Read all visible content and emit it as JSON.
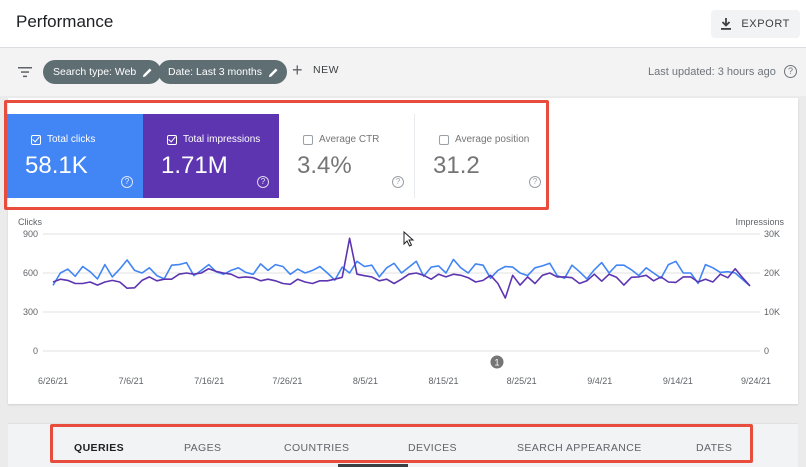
{
  "header": {
    "title": "Performance",
    "export_label": "EXPORT"
  },
  "filters": {
    "chips": [
      {
        "label": "Search type: Web"
      },
      {
        "label": "Date: Last 3 months"
      }
    ],
    "new_label": "NEW",
    "last_updated": "Last updated: 3 hours ago"
  },
  "metrics": [
    {
      "label": "Total clicks",
      "value": "58.1K",
      "checked": true,
      "color": "#4285f4"
    },
    {
      "label": "Total impressions",
      "value": "1.71M",
      "checked": true,
      "color": "#5e35b1"
    },
    {
      "label": "Average CTR",
      "value": "3.4%",
      "checked": false
    },
    {
      "label": "Average position",
      "value": "31.2",
      "checked": false
    }
  ],
  "chart": {
    "left_axis_label": "Clicks",
    "right_axis_label": "Impressions",
    "left_ticks": [
      "900",
      "600",
      "300",
      "0"
    ],
    "right_ticks": [
      "30K",
      "20K",
      "10K",
      "0"
    ],
    "x_labels": [
      "6/26/21",
      "7/6/21",
      "7/16/21",
      "7/26/21",
      "8/5/21",
      "8/15/21",
      "8/25/21",
      "9/4/21",
      "9/14/21",
      "9/24/21"
    ],
    "annotation_label": "1"
  },
  "chart_data": {
    "type": "line",
    "x_start": "6/24/21",
    "x_end": "9/24/21",
    "ylim_left": [
      0,
      900
    ],
    "ylim_right": [
      0,
      30000
    ],
    "series": [
      {
        "name": "Total clicks",
        "axis": "left",
        "color": "#4285f4",
        "values": [
          505,
          600,
          630,
          575,
          650,
          610,
          555,
          665,
          570,
          630,
          700,
          620,
          600,
          640,
          580,
          555,
          660,
          665,
          680,
          580,
          620,
          665,
          610,
          590,
          620,
          640,
          605,
          590,
          670,
          620,
          665,
          650,
          590,
          630,
          600,
          620,
          650,
          600,
          545,
          645,
          600,
          690,
          650,
          660,
          570,
          640,
          675,
          600,
          645,
          690,
          575,
          645,
          655,
          600,
          705,
          640,
          600,
          670,
          660,
          560,
          620,
          650,
          645,
          600,
          580,
          640,
          655,
          675,
          580,
          560,
          660,
          610,
          555,
          625,
          680,
          600,
          660,
          660,
          625,
          580,
          640,
          600,
          560,
          665,
          690,
          600,
          600,
          520,
          665,
          640,
          605,
          610,
          600,
          550,
          500
        ]
      },
      {
        "name": "Total impressions",
        "axis": "right",
        "color": "#5e35b1",
        "values": [
          17700,
          18400,
          18100,
          17300,
          17300,
          17700,
          16900,
          17700,
          18100,
          17700,
          16100,
          16200,
          18100,
          19000,
          18000,
          18400,
          18400,
          19700,
          20000,
          19700,
          20000,
          21100,
          20400,
          20000,
          19700,
          18800,
          19000,
          18800,
          18000,
          18400,
          18000,
          17300,
          17100,
          18400,
          17700,
          17300,
          18000,
          18000,
          18400,
          18900,
          28900,
          19700,
          19300,
          19000,
          18000,
          18400,
          17300,
          18400,
          19700,
          20000,
          19400,
          18400,
          19700,
          19000,
          19700,
          19400,
          18800,
          17700,
          18100,
          19400,
          17300,
          13600,
          19400,
          16900,
          19000,
          17300,
          19400,
          20000,
          19000,
          19000,
          18800,
          17300,
          18000,
          19700,
          17900,
          19700,
          18900,
          16900,
          18900,
          19000,
          19400,
          18000,
          19000,
          17700,
          17600,
          19000,
          19000,
          17700,
          18400,
          17700,
          19700,
          18800,
          21100,
          18800,
          16700
        ]
      }
    ]
  },
  "tabs": [
    "QUERIES",
    "PAGES",
    "COUNTRIES",
    "DEVICES",
    "SEARCH APPEARANCE",
    "DATES"
  ]
}
